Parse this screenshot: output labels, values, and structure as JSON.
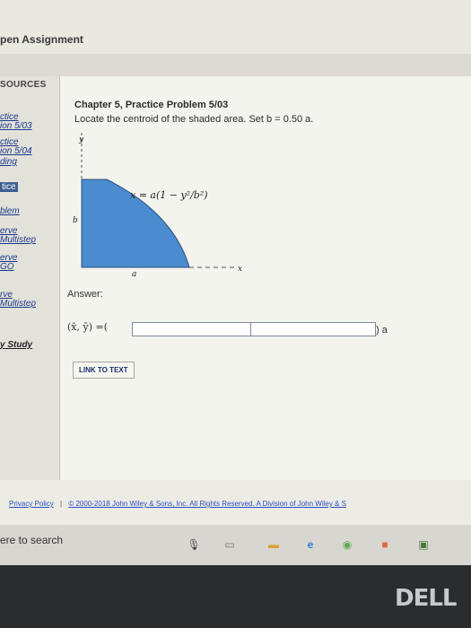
{
  "app": {
    "title": "pen Assignment"
  },
  "sidebar": {
    "header": "SOURCES",
    "items": [
      {
        "label": "ctice"
      },
      {
        "label": "ion 5/03"
      },
      {
        "label": "ctice"
      },
      {
        "label": "ion 5/04"
      },
      {
        "label": "ding"
      },
      {
        "label": "tice"
      },
      {
        "label": "blem"
      },
      {
        "label": "erve"
      },
      {
        "label": "Multistep"
      },
      {
        "label": "erve"
      },
      {
        "label": "GO"
      },
      {
        "label": "rve"
      },
      {
        "label": "Multistep"
      },
      {
        "label": "y Study"
      }
    ]
  },
  "problem": {
    "title": "Chapter 5, Practice Problem 5/03",
    "description": "Locate the centroid of the shaded area. Set b = 0.50 a.",
    "figure": {
      "y_axis_label": "y",
      "x_axis_label": "x",
      "b_label": "b",
      "a_label": "a",
      "equation": "x = a(1 − y²/b²)",
      "fill_color": "#4a8ccf"
    }
  },
  "answer": {
    "label": "Answer:",
    "coord_label": "(x̄, ȳ) =(",
    "x_value": "",
    "y_value": "",
    "unit": ") a",
    "link_label": "LINK TO TEXT"
  },
  "footer": {
    "privacy": "Privacy Policy",
    "separator": "|",
    "copyright": "© 2000-2018 John Wiley & Sons, Inc. All Rights Reserved. A Division of John Wiley & S"
  },
  "taskbar": {
    "search_text": "ere to search",
    "icons": [
      "microphone-icon",
      "task-view-icon",
      "file-explorer-icon",
      "edge-icon",
      "chrome-icon",
      "media-icon",
      "store-icon"
    ]
  },
  "monitor": {
    "brand": "DELL"
  }
}
